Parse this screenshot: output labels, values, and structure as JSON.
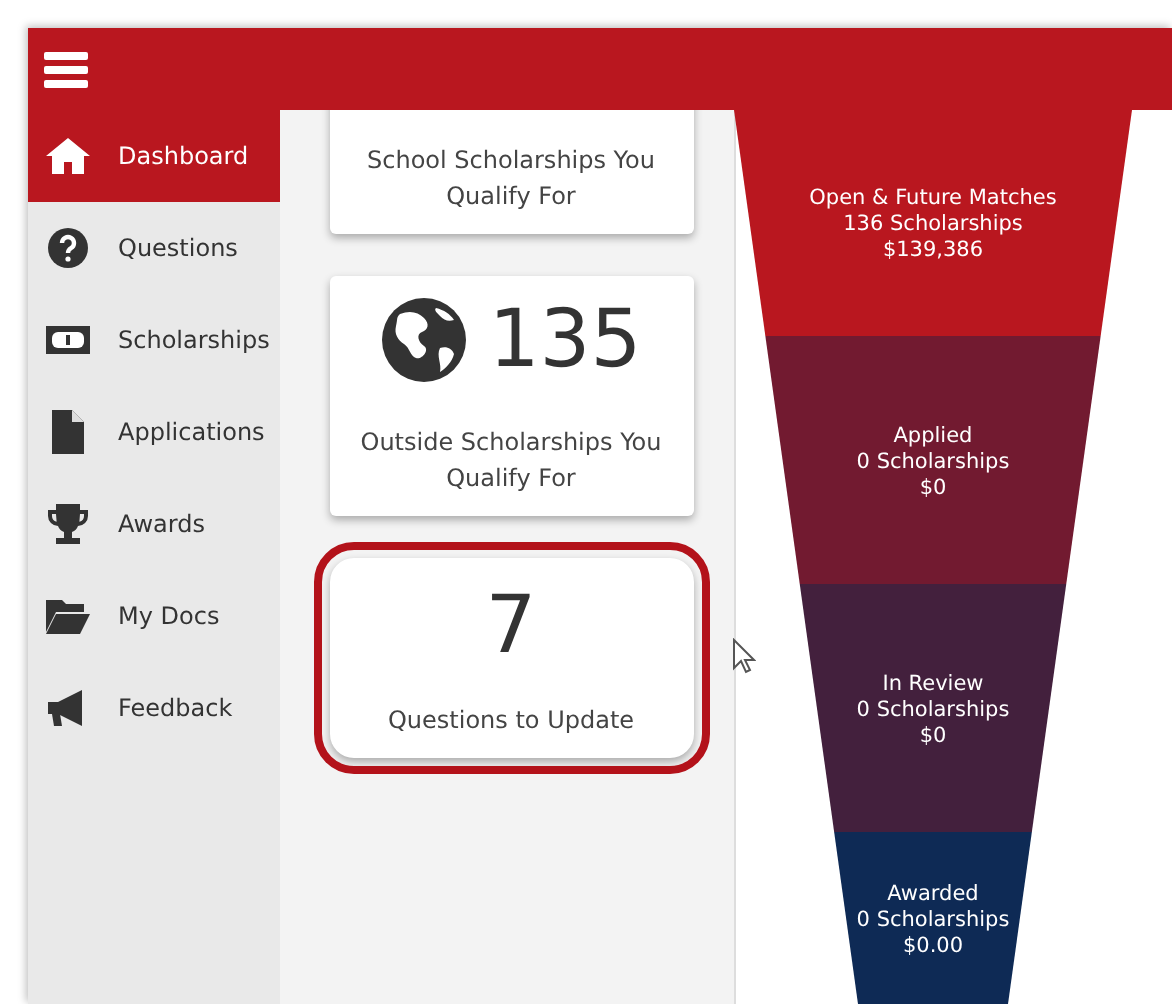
{
  "sidebar": {
    "items": [
      {
        "label": "Dashboard",
        "selected": true
      },
      {
        "label": "Questions",
        "selected": false
      },
      {
        "label": "Scholarships",
        "selected": false
      },
      {
        "label": "Applications",
        "selected": false
      },
      {
        "label": "Awards",
        "selected": false
      },
      {
        "label": "My Docs",
        "selected": false
      },
      {
        "label": "Feedback",
        "selected": false
      }
    ]
  },
  "cards": [
    {
      "kind": "label_only",
      "label": "School Scholarships You Qualify For",
      "highlighted": false
    },
    {
      "kind": "globe_count",
      "value": "135",
      "label": "Outside Scholarships You Qualify For",
      "highlighted": false
    },
    {
      "kind": "count",
      "value": "7",
      "label": "Questions to Update",
      "highlighted": true
    }
  ],
  "funnel": {
    "stages": [
      {
        "title": "Open & Future Matches",
        "count": "136 Scholarships",
        "amount": "$139,386",
        "color": "#b9171f"
      },
      {
        "title": "Applied",
        "count": "0 Scholarships",
        "amount": "$0",
        "color": "#721a30"
      },
      {
        "title": "In Review",
        "count": "0 Scholarships",
        "amount": "$0",
        "color": "#43203d"
      },
      {
        "title": "Awarded",
        "count": "0 Scholarships",
        "amount": "$0.00",
        "color": "#0e2a55"
      }
    ]
  }
}
